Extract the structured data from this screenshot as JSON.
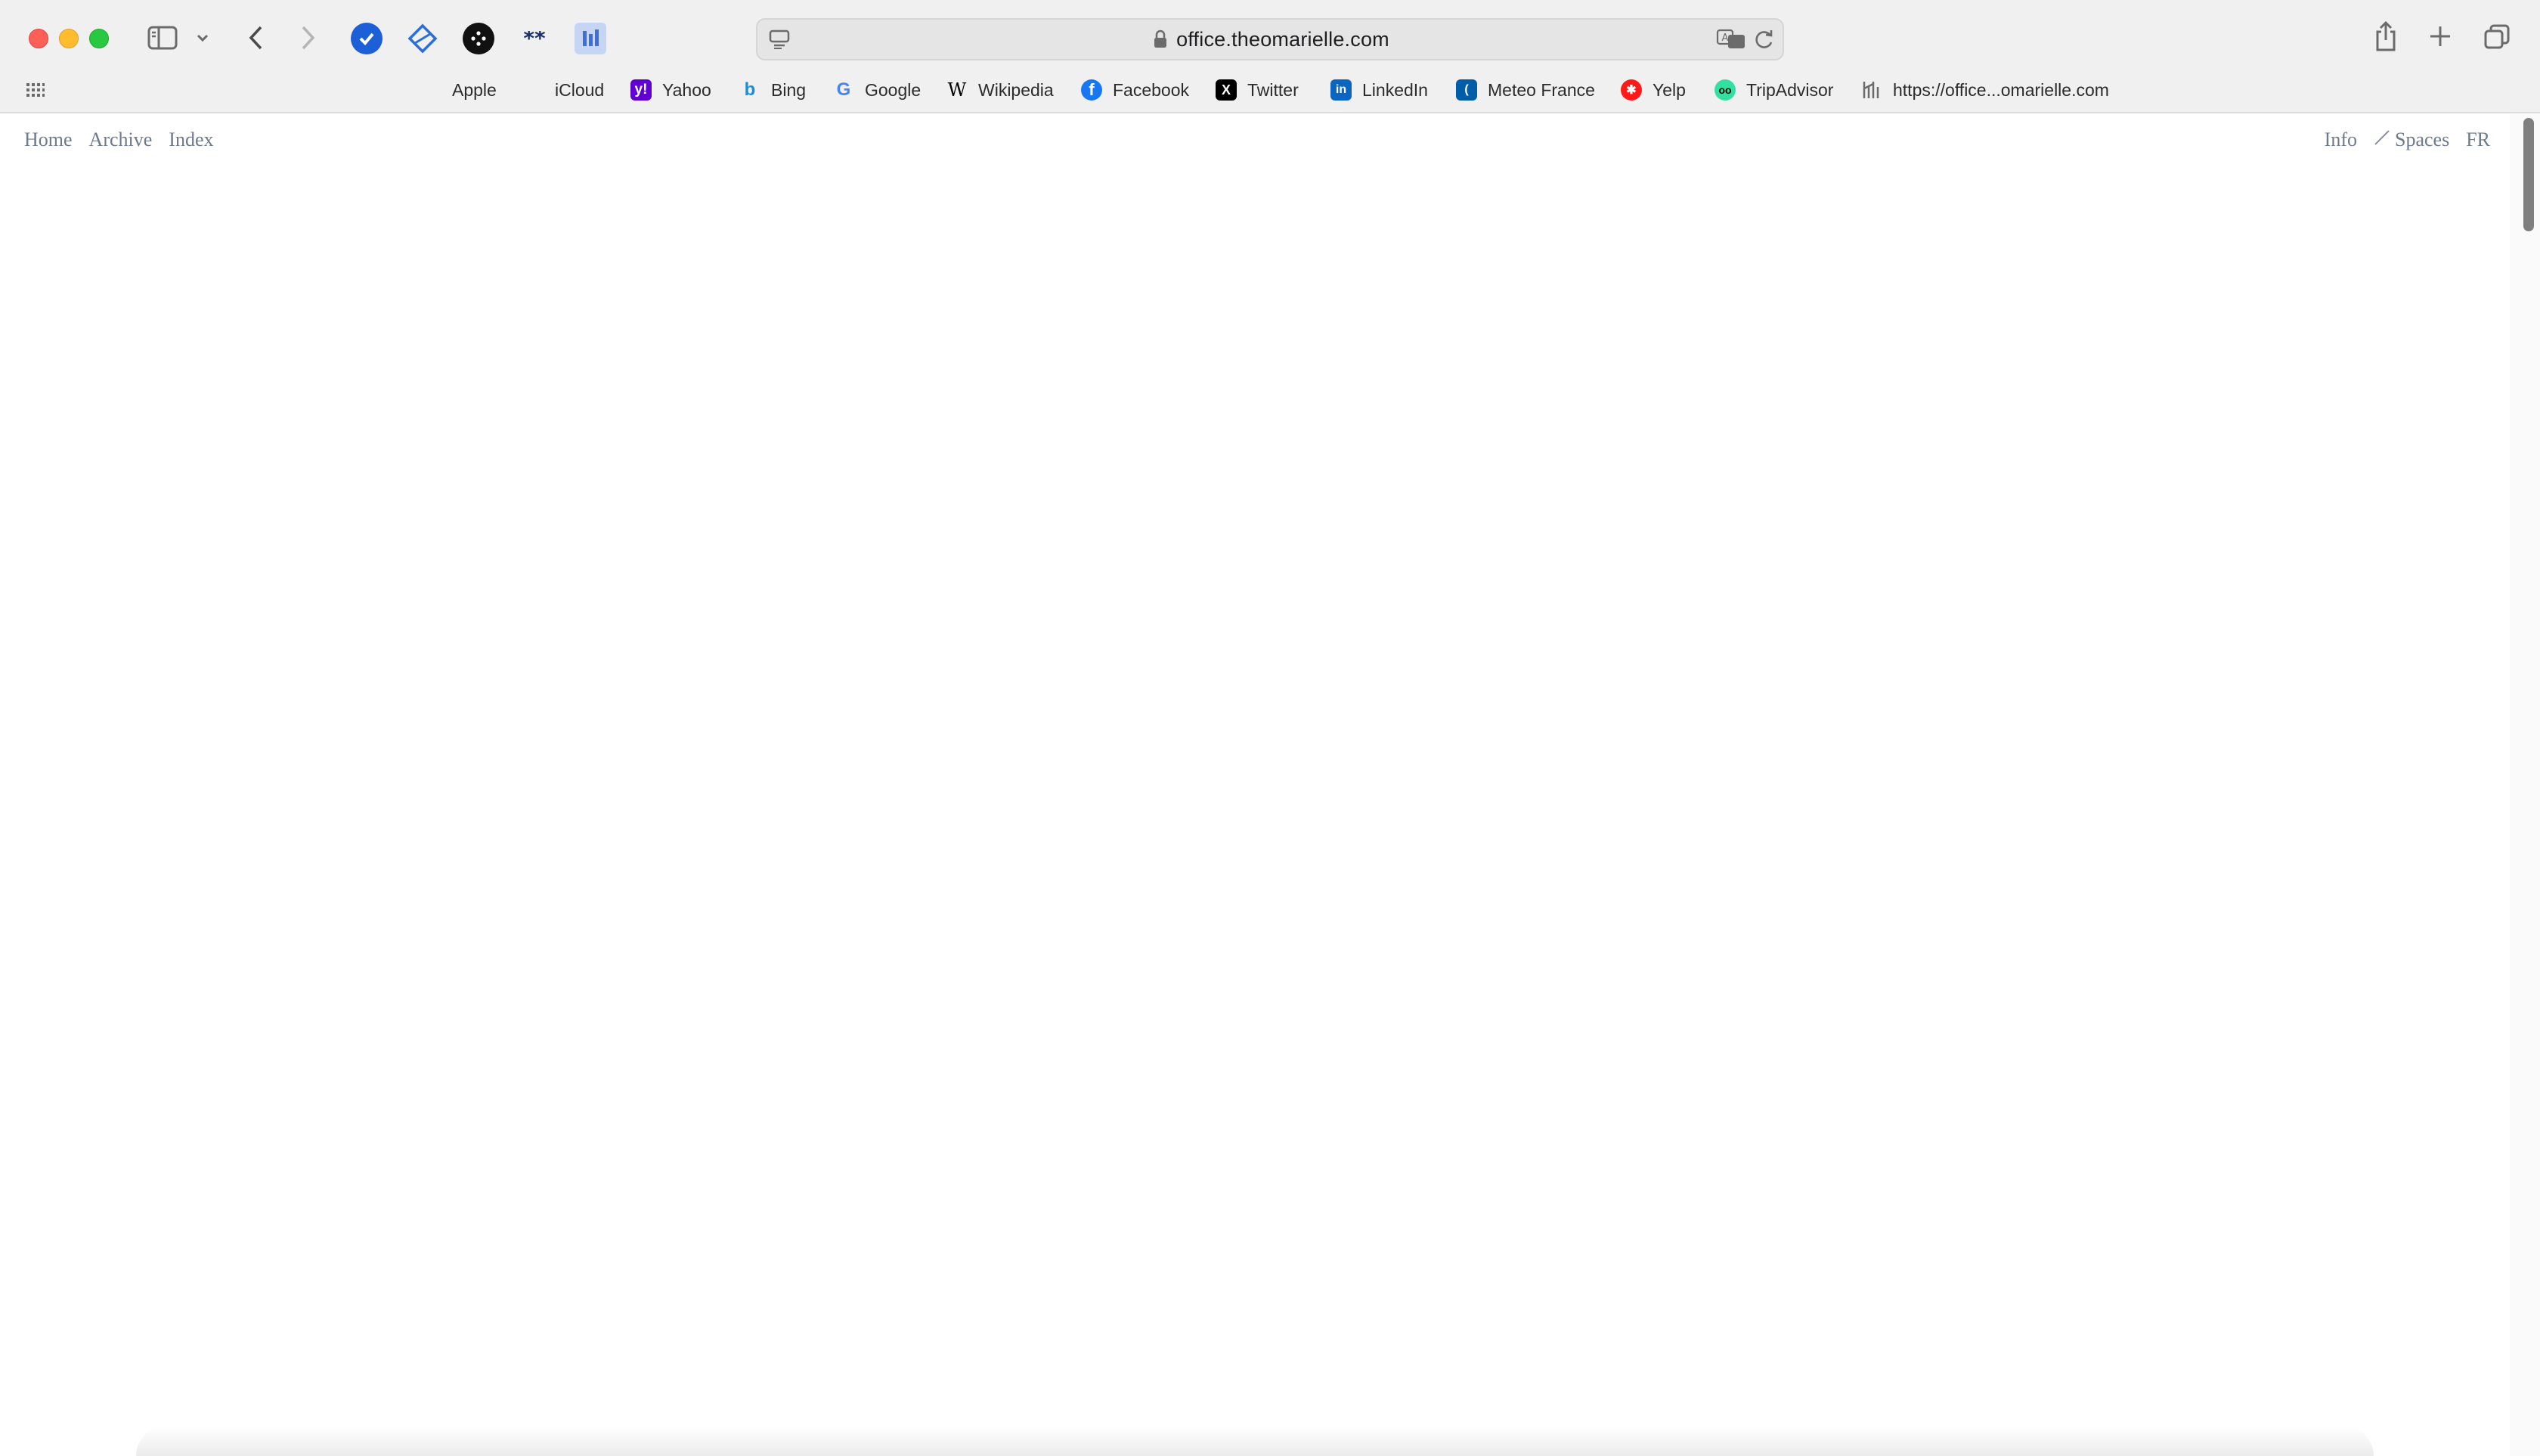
{
  "browser": {
    "url": "office.theomarielle.com",
    "bookmarks": [
      {
        "label": "Apple",
        "icon": "apple-icon",
        "color": "#1d1d1f"
      },
      {
        "label": "iCloud",
        "icon": "apple-icon",
        "color": "#555555"
      },
      {
        "label": "Yahoo",
        "icon": "yahoo-icon",
        "color": "#6001d2"
      },
      {
        "label": "Bing",
        "icon": "bing-icon",
        "color": "#1a8cd8"
      },
      {
        "label": "Google",
        "icon": "google-icon",
        "color": "#4285f4"
      },
      {
        "label": "Wikipedia",
        "icon": "wikipedia-icon",
        "color": "#000000"
      },
      {
        "label": "Facebook",
        "icon": "facebook-icon",
        "color": "#1877f2"
      },
      {
        "label": "Twitter",
        "icon": "x-icon",
        "color": "#000000"
      },
      {
        "label": "LinkedIn",
        "icon": "linkedin-icon",
        "color": "#0a66c2"
      },
      {
        "label": "Meteo France",
        "icon": "meteo-france-icon",
        "color": "#005ea8"
      },
      {
        "label": "Yelp",
        "icon": "yelp-icon",
        "color": "#ff1a1a"
      },
      {
        "label": "TripAdvisor",
        "icon": "tripadvisor-icon",
        "color": "#34e0a1"
      },
      {
        "label": "https://office...omarielle.com",
        "icon": "site-icon",
        "color": "#6b6b6b"
      }
    ]
  },
  "site": {
    "nav_left": [
      "Home",
      "Archive",
      "Index"
    ],
    "nav_right": {
      "info": "Info",
      "spaces": "Spaces",
      "lang": "FR"
    }
  }
}
